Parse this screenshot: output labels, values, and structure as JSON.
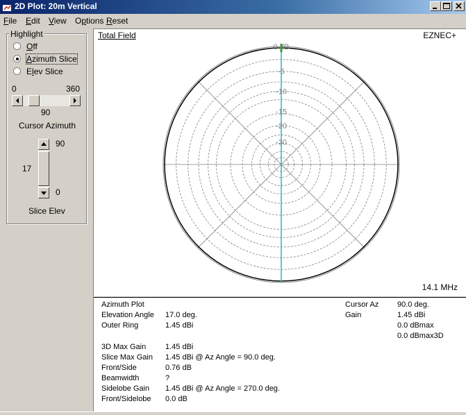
{
  "window": {
    "title": "2D Plot: 20m Vertical"
  },
  "menu": [
    {
      "mnemonic": "F",
      "rest": "ile"
    },
    {
      "mnemonic": "E",
      "rest": "dit"
    },
    {
      "mnemonic": "V",
      "rest": "iew"
    },
    {
      "pre": "O",
      "mnemonic": "p",
      "rest": "tions"
    },
    {
      "mnemonic": "R",
      "rest": "eset"
    }
  ],
  "highlight": {
    "group_label": "Highlight",
    "options": [
      {
        "pre": "",
        "mnemonic": "O",
        "rest": "ff",
        "selected": false
      },
      {
        "pre": "",
        "mnemonic": "A",
        "rest": "zimuth Slice",
        "selected": true
      },
      {
        "pre": "E",
        "mnemonic": "l",
        "rest": "ev Slice",
        "selected": false
      }
    ]
  },
  "cursor_azimuth": {
    "min_label": "0",
    "max_label": "360",
    "value": "90",
    "label": "Cursor Azimuth"
  },
  "slice_elev": {
    "max_label": "90",
    "min_label": "0",
    "value": "17",
    "label": "Slice Elev"
  },
  "plot": {
    "title": "Total Field",
    "brand": "EZNEC+",
    "frequency": "14.1 MHz",
    "ring_labels": [
      "0 dB",
      "-5",
      "-10",
      "-15",
      "-20",
      "-30"
    ],
    "cursor_azimuth_deg": 90,
    "colors": {
      "pattern": "#000000",
      "cursor": "#33b3e6",
      "highlight": "#22aa22",
      "grid": "#808080"
    }
  },
  "info": {
    "left": [
      {
        "label": "Azimuth Plot",
        "value": ""
      },
      {
        "label": "Elevation Angle",
        "value": "17.0 deg."
      },
      {
        "label": "Outer Ring",
        "value": "1.45 dBi"
      }
    ],
    "left2": [
      {
        "label": "3D Max Gain",
        "value": "1.45 dBi"
      },
      {
        "label": "Slice Max Gain",
        "value": "1.45 dBi @ Az Angle = 90.0 deg."
      },
      {
        "label": "Front/Side",
        "value": "0.76 dB"
      },
      {
        "label": "Beamwidth",
        "value": "?"
      },
      {
        "label": "Sidelobe Gain",
        "value": "1.45 dBi @ Az Angle = 270.0 deg."
      },
      {
        "label": "Front/Sidelobe",
        "value": "0.0 dB"
      }
    ],
    "right": [
      {
        "label": "Cursor Az",
        "value": "90.0 deg."
      },
      {
        "label": "Gain",
        "value": "1.45 dBi"
      },
      {
        "label": "",
        "value": "0.0 dBmax"
      },
      {
        "label": "",
        "value": "0.0 dBmax3D"
      }
    ]
  }
}
